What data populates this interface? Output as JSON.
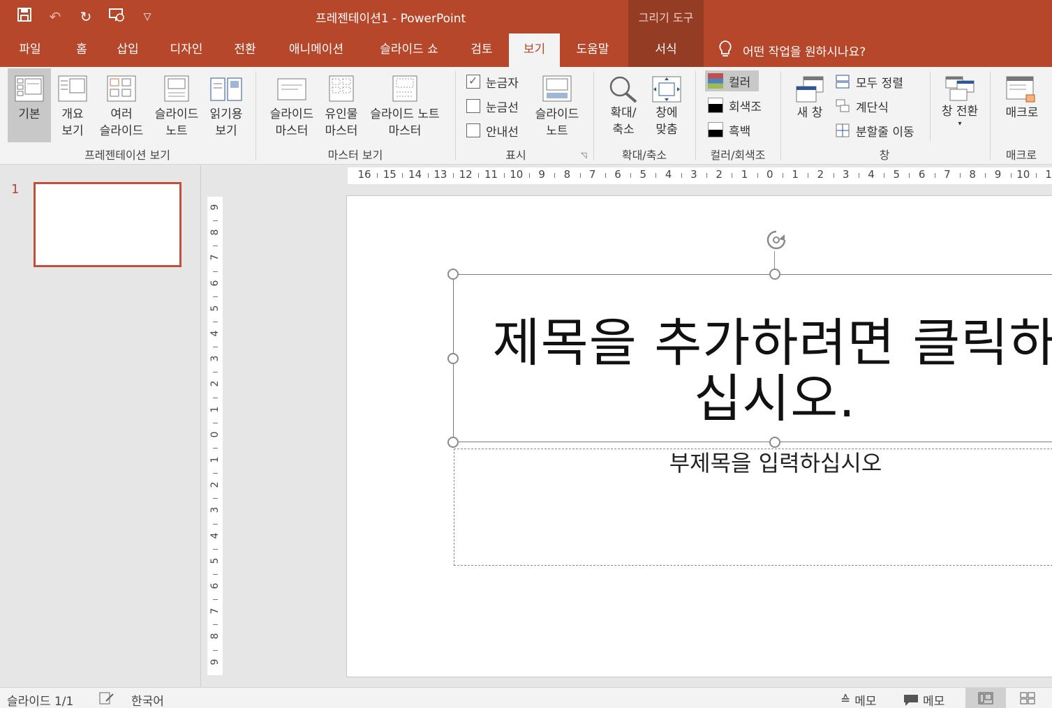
{
  "title_bar": {
    "doc_title": "프레젠테이션1  -  PowerPoint",
    "context_tools_label": "그리기 도구"
  },
  "tabs": [
    {
      "label": "파일"
    },
    {
      "label": "홈"
    },
    {
      "label": "삽입"
    },
    {
      "label": "디자인"
    },
    {
      "label": "전환"
    },
    {
      "label": "애니메이션"
    },
    {
      "label": "슬라이드 쇼"
    },
    {
      "label": "검토"
    },
    {
      "label": "보기"
    },
    {
      "label": "도움말"
    },
    {
      "label": "서식"
    }
  ],
  "tell_me": "어떤 작업을 원하시나요?",
  "ribbon": {
    "presentation_views": {
      "label": "프레젠테이션 보기",
      "normal": "기본",
      "outline_1": "개요",
      "outline_2": "보기",
      "sorter_1": "여러",
      "sorter_2": "슬라이드",
      "notes_1": "슬라이드",
      "notes_2": "노트",
      "reading_1": "읽기용",
      "reading_2": "보기"
    },
    "master_views": {
      "label": "마스터 보기",
      "slide_master_1": "슬라이드",
      "slide_master_2": "마스터",
      "handout_master_1": "유인물",
      "handout_master_2": "마스터",
      "notes_master_1": "슬라이드 노트",
      "notes_master_2": "마스터"
    },
    "show": {
      "label": "표시",
      "ruler": "눈금자",
      "gridlines": "눈금선",
      "guides": "안내선",
      "notes_1": "슬라이드",
      "notes_2": "노트"
    },
    "zoom": {
      "label": "확대/축소",
      "zoom_1": "확대/",
      "zoom_2": "축소",
      "fit_1": "창에",
      "fit_2": "맞춤"
    },
    "color": {
      "label": "컬러/회색조",
      "color": "컬러",
      "grayscale": "회색조",
      "bw": "흑백"
    },
    "window": {
      "label": "창",
      "new_window_1": "새 창",
      "arrange_all": "모두 정렬",
      "cascade": "계단식",
      "move_split": "분할줄 이동",
      "switch_1": "창 전환"
    },
    "macros": {
      "label": "매크로",
      "macros": "매크로"
    }
  },
  "thumbnails": {
    "slide_number": "1"
  },
  "hruler_ticks": [
    "16",
    "15",
    "14",
    "13",
    "12",
    "11",
    "10",
    "9",
    "8",
    "7",
    "6",
    "5",
    "4",
    "3",
    "2",
    "1",
    "0",
    "1",
    "2",
    "3",
    "4",
    "5",
    "6",
    "7",
    "8",
    "9",
    "10",
    "1"
  ],
  "vruler_ticks": [
    "9",
    "8",
    "7",
    "6",
    "5",
    "4",
    "3",
    "2",
    "1",
    "0",
    "1",
    "2",
    "3",
    "4",
    "5",
    "6",
    "7",
    "8",
    "9"
  ],
  "slide": {
    "title_line1": "제목을 추가하려면 클릭하",
    "title_line2": "십시오.",
    "subtitle": "부제목을 입력하십시오"
  },
  "status": {
    "slide_count": "슬라이드 1/1",
    "language": "한국어",
    "notes": "메모",
    "comments": "메모"
  },
  "colors": {
    "accent": "#b7472a",
    "context": "#953c24"
  }
}
